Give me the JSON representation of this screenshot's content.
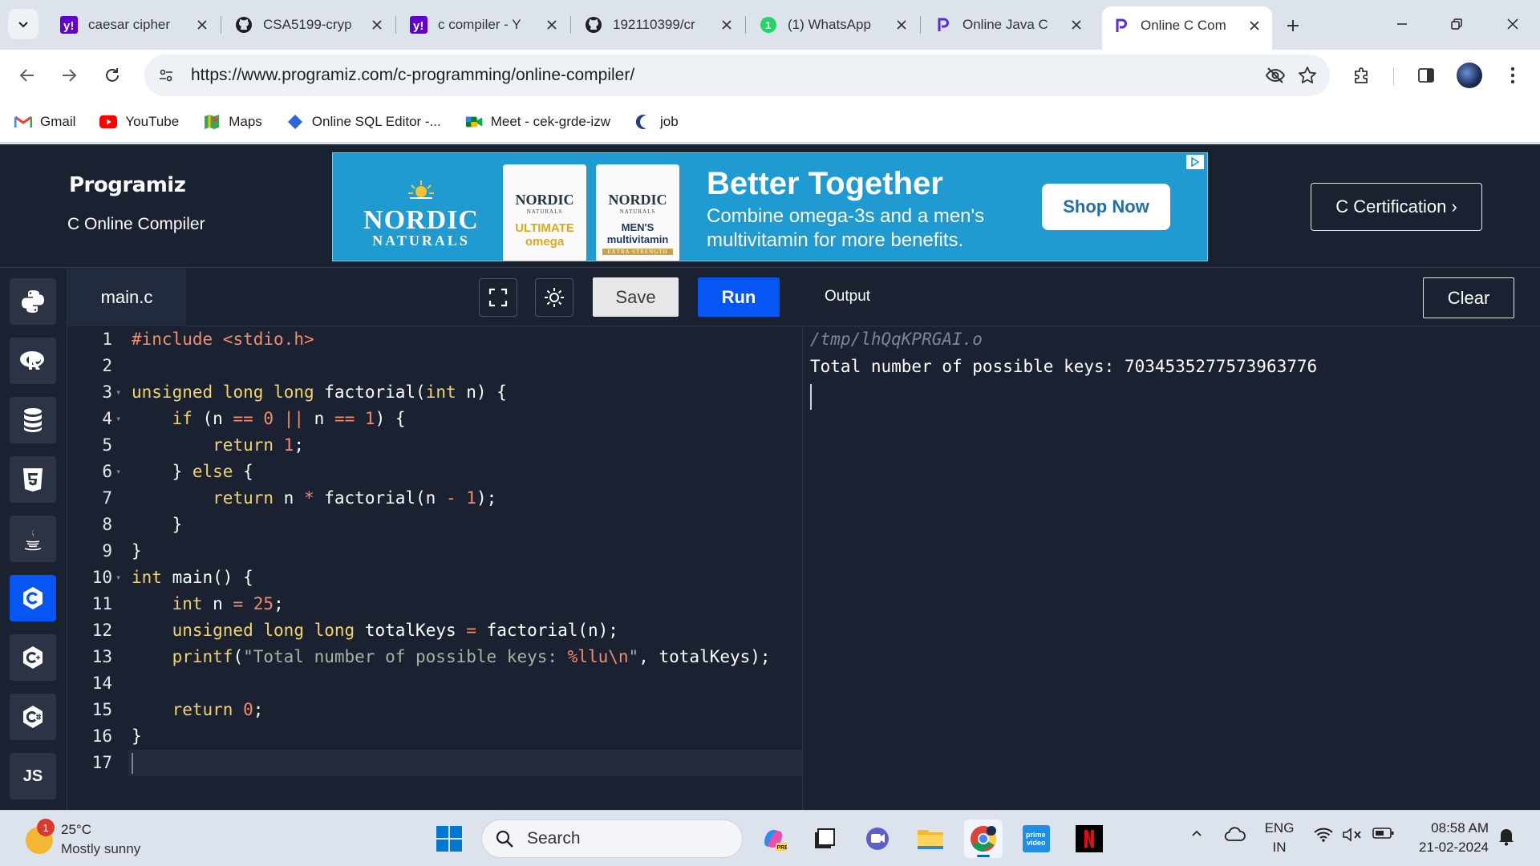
{
  "browser": {
    "tabs": [
      {
        "title": "caesar cipher",
        "favicon": "yahoo-icon"
      },
      {
        "title": "CSA5199-cryp",
        "favicon": "github-icon"
      },
      {
        "title": "c compiler - Y",
        "favicon": "yahoo-icon"
      },
      {
        "title": "192110399/cr",
        "favicon": "github-icon"
      },
      {
        "title": "(1) WhatsApp",
        "favicon": "whatsapp-icon"
      },
      {
        "title": "Online Java C",
        "favicon": "programiz-icon"
      },
      {
        "title": "Online C Com",
        "favicon": "programiz-icon",
        "active": true
      }
    ],
    "url": "https://www.programiz.com/c-programming/online-compiler/",
    "bookmarks": [
      {
        "label": "Gmail",
        "icon": "gmail-icon"
      },
      {
        "label": "YouTube",
        "icon": "youtube-icon"
      },
      {
        "label": "Maps",
        "icon": "maps-icon"
      },
      {
        "label": "Online SQL Editor -...",
        "icon": "sql-icon"
      },
      {
        "label": "Meet - cek-grde-izw",
        "icon": "meet-icon"
      },
      {
        "label": "job",
        "icon": "job-icon"
      }
    ]
  },
  "site": {
    "logo": "Programiz",
    "subtitle": "C Online Compiler",
    "certification_button": "C Certification ›",
    "ad": {
      "brand": "NORDIC",
      "brand_sub": "NATURALS",
      "bottle1_name": "NORDIC",
      "bottle1_sub": "NATURALS",
      "bottle1_tag": "ULTIMATE omega",
      "bottle2_name": "NORDIC",
      "bottle2_sub": "NATURALS",
      "bottle2_tag": "MEN'S multivitamin",
      "bottle2_strength": "EXTRA STRENGTH",
      "headline": "Better Together",
      "body": "Combine omega-3s and a men's multivitamin for more benefits.",
      "cta": "Shop Now"
    }
  },
  "editor": {
    "filename": "main.c",
    "save_label": "Save",
    "run_label": "Run",
    "lines": [
      "1",
      "2",
      "3",
      "4",
      "5",
      "6",
      "7",
      "8",
      "9",
      "10",
      "11",
      "12",
      "13",
      "14",
      "15",
      "16",
      "17"
    ]
  },
  "output": {
    "title": "Output",
    "clear_label": "Clear",
    "path": "/tmp/lhQqKPRGAI.o",
    "result": "Total number of possible keys: 7034535277573963776"
  },
  "taskbar": {
    "temperature": "25°C",
    "weather": "Mostly sunny",
    "weather_badge": "1",
    "search_placeholder": "Search",
    "lang_line1": "ENG",
    "lang_line2": "IN",
    "time": "08:58 AM",
    "date": "21-02-2024"
  }
}
